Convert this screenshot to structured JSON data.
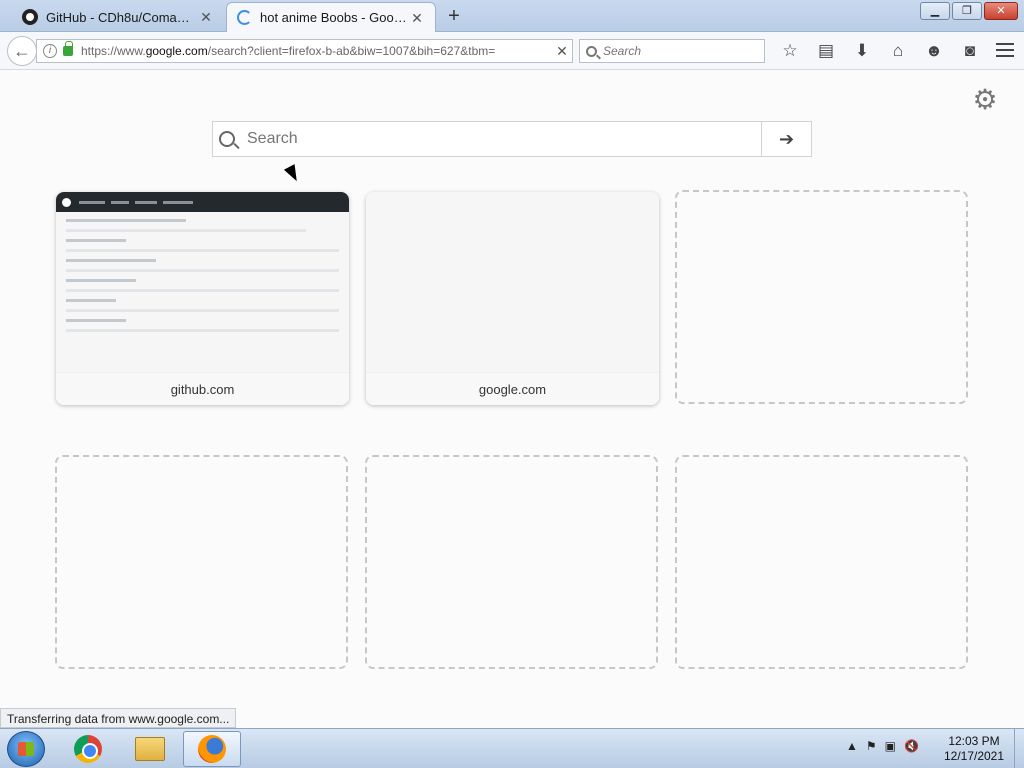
{
  "tabs": [
    {
      "title": "GitHub - CDh8u/ComaNo:...",
      "close": "✕"
    },
    {
      "title": "hot anime Boobs - Google ...",
      "close": "✕"
    }
  ],
  "new_tab": "+",
  "window_controls": {
    "minimize": "▁",
    "maximize": "❐",
    "close": "✕"
  },
  "navbar": {
    "url_prefix": "https://www.",
    "url_domain": "google.com",
    "url_rest": "/search?client=firefox-b-ab&biw=1007&bih=627&tbm=",
    "url_clear": "✕",
    "search_placeholder": "Search",
    "icons": [
      "bookmark-star-icon",
      "reading-list-icon",
      "downloads-icon",
      "home-icon",
      "hello-icon",
      "pocket-icon"
    ]
  },
  "newtab": {
    "search_placeholder": "Search",
    "go": "➔",
    "tiles": [
      {
        "label": "github.com",
        "type": "filled"
      },
      {
        "label": "google.com",
        "type": "filled"
      },
      {
        "label": "",
        "type": "empty"
      },
      {
        "label": "",
        "type": "empty"
      },
      {
        "label": "",
        "type": "empty"
      },
      {
        "label": "",
        "type": "empty"
      }
    ]
  },
  "status": "Transferring data from www.google.com...",
  "taskbar": {
    "clock_time": "12:03 PM",
    "clock_date": "12/17/2021",
    "tray": [
      "▲",
      "⚑",
      "▣",
      "🔇"
    ]
  },
  "colors": {
    "tabstrip": "#c9d9ee",
    "content_bg": "#fbfbfb",
    "taskbar": "#b7cbe3"
  }
}
